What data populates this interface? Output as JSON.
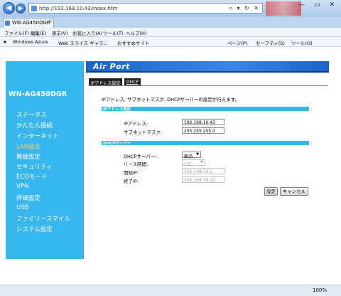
{
  "browser": {
    "address": "http://192.168.10.43/index.htm",
    "tab_title": "WN-AG450DGR",
    "tab_close": "×",
    "menus": [
      "ファイル(F)",
      "編集(E)",
      "表示(V)",
      "お気に入り(A)",
      "ツール(T)",
      "ヘルプ(H)"
    ],
    "favorites": [
      "Windows Azure",
      "Web スライス ギャラ...",
      "おすすめサイト"
    ],
    "commands": [
      "ページ(P)",
      "セーフティ(S)",
      "ツール(O)"
    ],
    "zoom": "100%"
  },
  "device": {
    "title": "WN-AG450DGR",
    "banner_logo": "Air Port"
  },
  "nav": {
    "items": [
      "ステータス",
      "かんたん接続",
      "インターネット",
      "LAN設定",
      "無線設定",
      "セキュリティ",
      "ECOモード",
      "VPN",
      "詳細設定",
      "USB",
      "ファミリースマイル",
      "システム設定"
    ],
    "active_index": 3
  },
  "tabs": {
    "ip": "IPアドレス設定",
    "dhcp": "DHCP"
  },
  "description": "IPアドレス, サブネットマスク, DHCPサーバーの設定が行えます。",
  "ip_section": {
    "title": "IPアドレス設定",
    "ip_label": "IPアドレス:",
    "ip_value": "192.168.10.43",
    "mask_label": "サブネットマスク:",
    "mask_value": "255.255.255.0"
  },
  "dhcp_section": {
    "title": "DHCPサーバー",
    "server_label": "DHCPサーバー:",
    "server_value": "無効",
    "lease_label": "リース時間:",
    "lease_value": "1日",
    "start_label": "開始IP:",
    "start_value": "192.168.10.2",
    "end_label": "終了IP:",
    "end_value": "192.168.10.32"
  },
  "buttons": {
    "save": "設定",
    "cancel": "キャンセル"
  },
  "colors": {
    "sidebar": "#37b6ee",
    "banner": "#1c64c4",
    "active_nav": "#f3d36a"
  }
}
